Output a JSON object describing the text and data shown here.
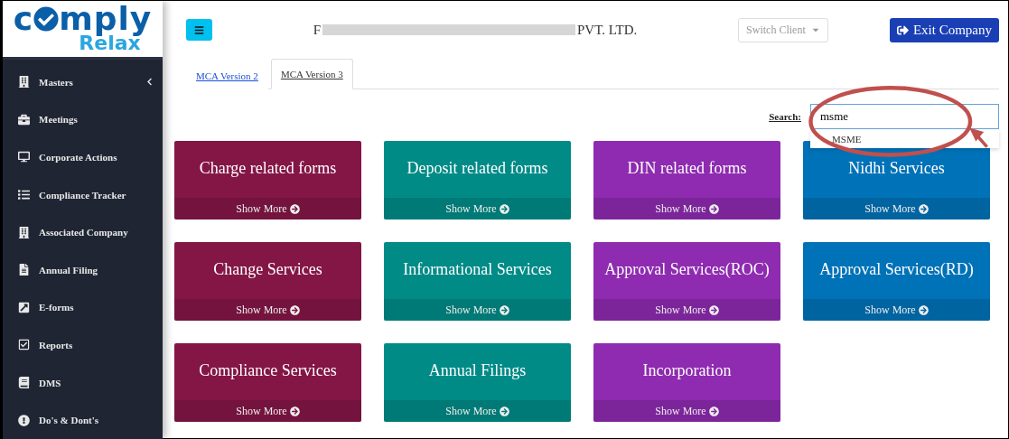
{
  "logo": {
    "start": "c",
    "end": "mply",
    "sub": "Relax"
  },
  "sidebar": {
    "items": [
      {
        "label": "Masters",
        "expandable": true
      },
      {
        "label": "Meetings",
        "expandable": false
      },
      {
        "label": "Corporate Actions",
        "expandable": false
      },
      {
        "label": "Compliance Tracker",
        "expandable": false
      },
      {
        "label": "Associated Company",
        "expandable": false
      },
      {
        "label": "Annual Filing",
        "expandable": false
      },
      {
        "label": "E-forms",
        "expandable": false
      },
      {
        "label": "Reports",
        "expandable": false
      },
      {
        "label": "DMS",
        "expandable": false
      },
      {
        "label": "Do's & Dont's",
        "expandable": false
      }
    ]
  },
  "header": {
    "company_start": "F",
    "company_redacted": true,
    "company_end": "PVT. LTD.",
    "switch_client": "Switch Client",
    "exit": "Exit Company"
  },
  "tabs": [
    {
      "label": "MCA Version 2",
      "selected": false
    },
    {
      "label": "MCA Version 3",
      "selected": true
    }
  ],
  "search": {
    "label": "Search:",
    "value": "msme",
    "suggestions": [
      "MSME"
    ]
  },
  "cards": [
    {
      "title": "Charge related forms",
      "action": "Show More",
      "color": "#841646"
    },
    {
      "title": "Deposit related forms",
      "action": "Show More",
      "color": "#008b87"
    },
    {
      "title": "DIN related forms",
      "action": "Show More",
      "color": "#8e2bb0"
    },
    {
      "title": "Nidhi Services",
      "action": "Show More",
      "color": "#0072b8"
    },
    {
      "title": "Change Services",
      "action": "Show More",
      "color": "#841646"
    },
    {
      "title": "Informational Services",
      "action": "Show More",
      "color": "#008b87"
    },
    {
      "title": "Approval Services(ROC)",
      "action": "Show More",
      "color": "#8e2bb0"
    },
    {
      "title": "Approval Services(RD)",
      "action": "Show More",
      "color": "#0072b8"
    },
    {
      "title": "Compliance Services",
      "action": "Show More",
      "color": "#841646"
    },
    {
      "title": "Annual Filings",
      "action": "Show More",
      "color": "#008b87"
    },
    {
      "title": "Incorporation",
      "action": "Show More",
      "color": "#8e2bb0"
    }
  ]
}
